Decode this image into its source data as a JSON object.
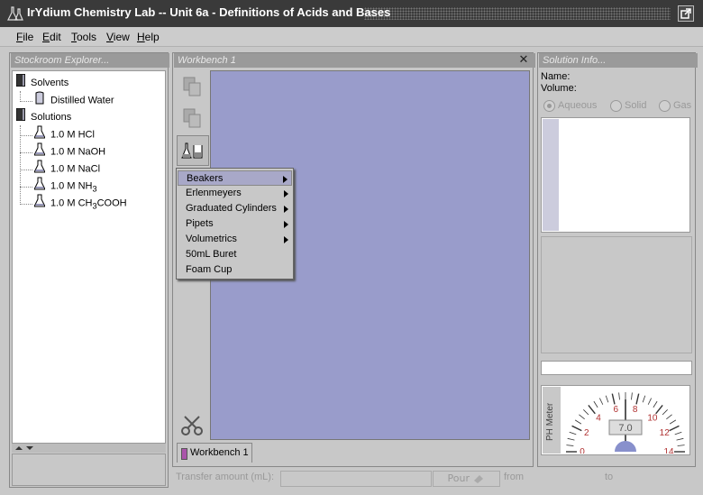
{
  "window": {
    "title": "IrYdium Chemistry Lab -- Unit 6a - Definitions of Acids and Bases"
  },
  "menubar": {
    "items": [
      {
        "label": "File",
        "mnemonic": "F",
        "rest": "ile"
      },
      {
        "label": "Edit",
        "mnemonic": "E",
        "rest": "dit"
      },
      {
        "label": "Tools",
        "mnemonic": "T",
        "rest": "ools"
      },
      {
        "label": "View",
        "mnemonic": "V",
        "rest": "iew"
      },
      {
        "label": "Help",
        "mnemonic": "H",
        "rest": "elp"
      }
    ]
  },
  "stockroom": {
    "header": "Stockroom Explorer...",
    "groups": [
      {
        "label": "Solvents",
        "items": [
          {
            "label": "Distilled Water",
            "icon": "bottle-icon"
          }
        ]
      },
      {
        "label": "Solutions",
        "items": [
          {
            "label": "1.0 M HCl",
            "icon": "flask-icon"
          },
          {
            "label": "1.0 M NaOH",
            "icon": "flask-icon"
          },
          {
            "label": "1.0 M NaCl",
            "icon": "flask-icon"
          },
          {
            "label_main": "1.0 M NH",
            "sub": "3",
            "label_tail": "",
            "icon": "flask-icon"
          },
          {
            "label_main": "1.0 M CH",
            "sub": "3",
            "label_tail": "COOH",
            "icon": "flask-icon"
          }
        ]
      }
    ]
  },
  "workbench": {
    "header": "Workbench 1",
    "tab_label": "Workbench 1",
    "canvas_color": "#999ccb"
  },
  "glassware_menu": {
    "items": [
      {
        "label": "Beakers",
        "submenu": true,
        "selected": true
      },
      {
        "label": "Erlenmeyers",
        "submenu": true
      },
      {
        "label": "Graduated Cylinders",
        "submenu": true
      },
      {
        "label": "Pipets",
        "submenu": true
      },
      {
        "label": "Volumetrics",
        "submenu": true
      },
      {
        "label": "50mL Buret",
        "submenu": false
      },
      {
        "label": "Foam Cup",
        "submenu": false
      }
    ]
  },
  "solution_info": {
    "header": "Solution Info...",
    "name_label": "Name:",
    "volume_label": "Volume:",
    "phases": [
      {
        "label": "Aqueous",
        "selected": true
      },
      {
        "label": "Solid",
        "selected": false
      },
      {
        "label": "Gas",
        "selected": false
      }
    ]
  },
  "ph_meter": {
    "label": "PH Meter",
    "reading": "7.0",
    "scale": [
      "0",
      "2",
      "4",
      "6",
      "8",
      "10",
      "12",
      "14"
    ]
  },
  "transfer": {
    "amount_label": "Transfer amount (mL):",
    "pour_label": "Pour",
    "from_label": "from",
    "to_label": "to"
  }
}
